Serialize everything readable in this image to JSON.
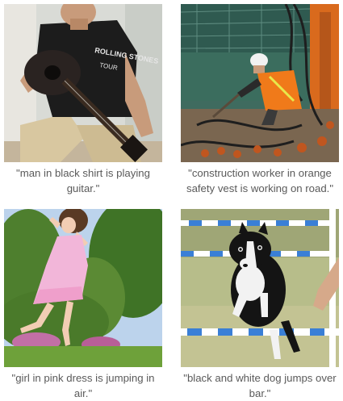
{
  "gallery": {
    "items": [
      {
        "caption": "\"man in black shirt is playing guitar.\"",
        "shirt_text": "ROLLING STONES",
        "shirt_subtext": "TOUR",
        "image_icon": "guitar-player-photo"
      },
      {
        "caption": "\"construction worker in orange safety vest is working on road.\"",
        "image_icon": "construction-worker-photo"
      },
      {
        "caption": "\"girl in pink dress is jumping in air.\"",
        "image_icon": "girl-jumping-photo"
      },
      {
        "caption": "\"black and white dog jumps over bar.\"",
        "image_icon": "dog-agility-photo"
      }
    ]
  },
  "colors": {
    "caption_text": "#5a5a5a",
    "vest_orange": "#f07a1a",
    "dress_pink": "#f2b6d9",
    "bar_blue": "#3a7fd6"
  }
}
